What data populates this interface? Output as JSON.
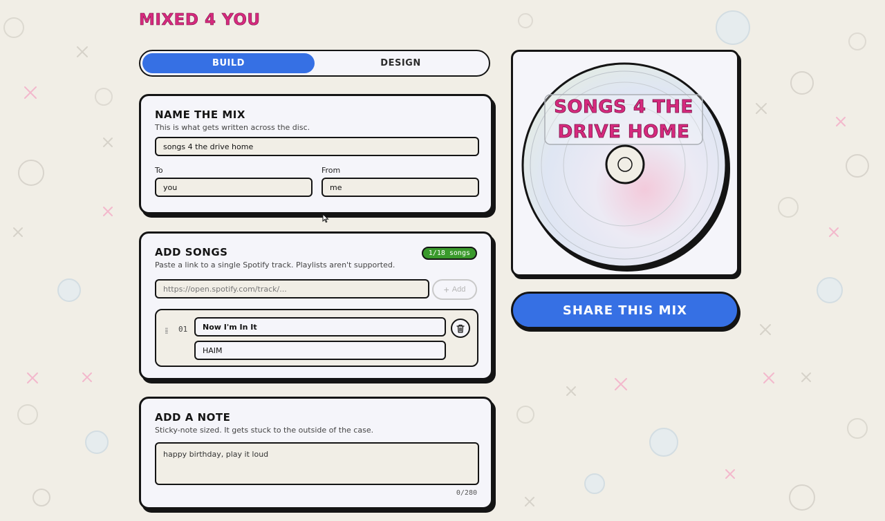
{
  "app": {
    "title": "MIXED 4 YOU"
  },
  "tabs": [
    {
      "label": "BUILD",
      "active": true
    },
    {
      "label": "DESIGN",
      "active": false
    }
  ],
  "name_section": {
    "heading": "NAME THE MIX",
    "subtitle": "This is what gets written across the disc.",
    "mix_name_value": "songs 4 the drive home",
    "to_label": "To",
    "to_value": "you",
    "from_label": "From",
    "from_value": "me"
  },
  "songs_section": {
    "heading": "ADD SONGS",
    "subtitle": "Paste a link to a single Spotify track. Playlists aren't supported.",
    "count_badge": "1/18 songs",
    "link_placeholder": "https://open.spotify.com/track/...",
    "add_label": "Add",
    "songs": [
      {
        "number": "01",
        "title": "Now I'm In It",
        "artist": "HAIM"
      }
    ]
  },
  "note_section": {
    "heading": "ADD A NOTE",
    "subtitle": "Sticky-note sized. It gets stuck to the outside of the case.",
    "placeholder": "happy birthday, play it loud",
    "counter": "0/280"
  },
  "preview": {
    "disc_line_1": "SONGS 4 THE",
    "disc_line_2": "DRIVE HOME"
  },
  "share": {
    "label": "SHARE THIS MIX"
  },
  "colors": {
    "accent_blue": "#3670e4",
    "title_pink": "#d62a7e",
    "badge_green": "#3a9a2c",
    "background": "#f1eee6",
    "card": "#f5f5fa"
  },
  "icons": [
    "plus-icon",
    "drag-handle-icon",
    "trash-icon",
    "cursor-icon"
  ]
}
